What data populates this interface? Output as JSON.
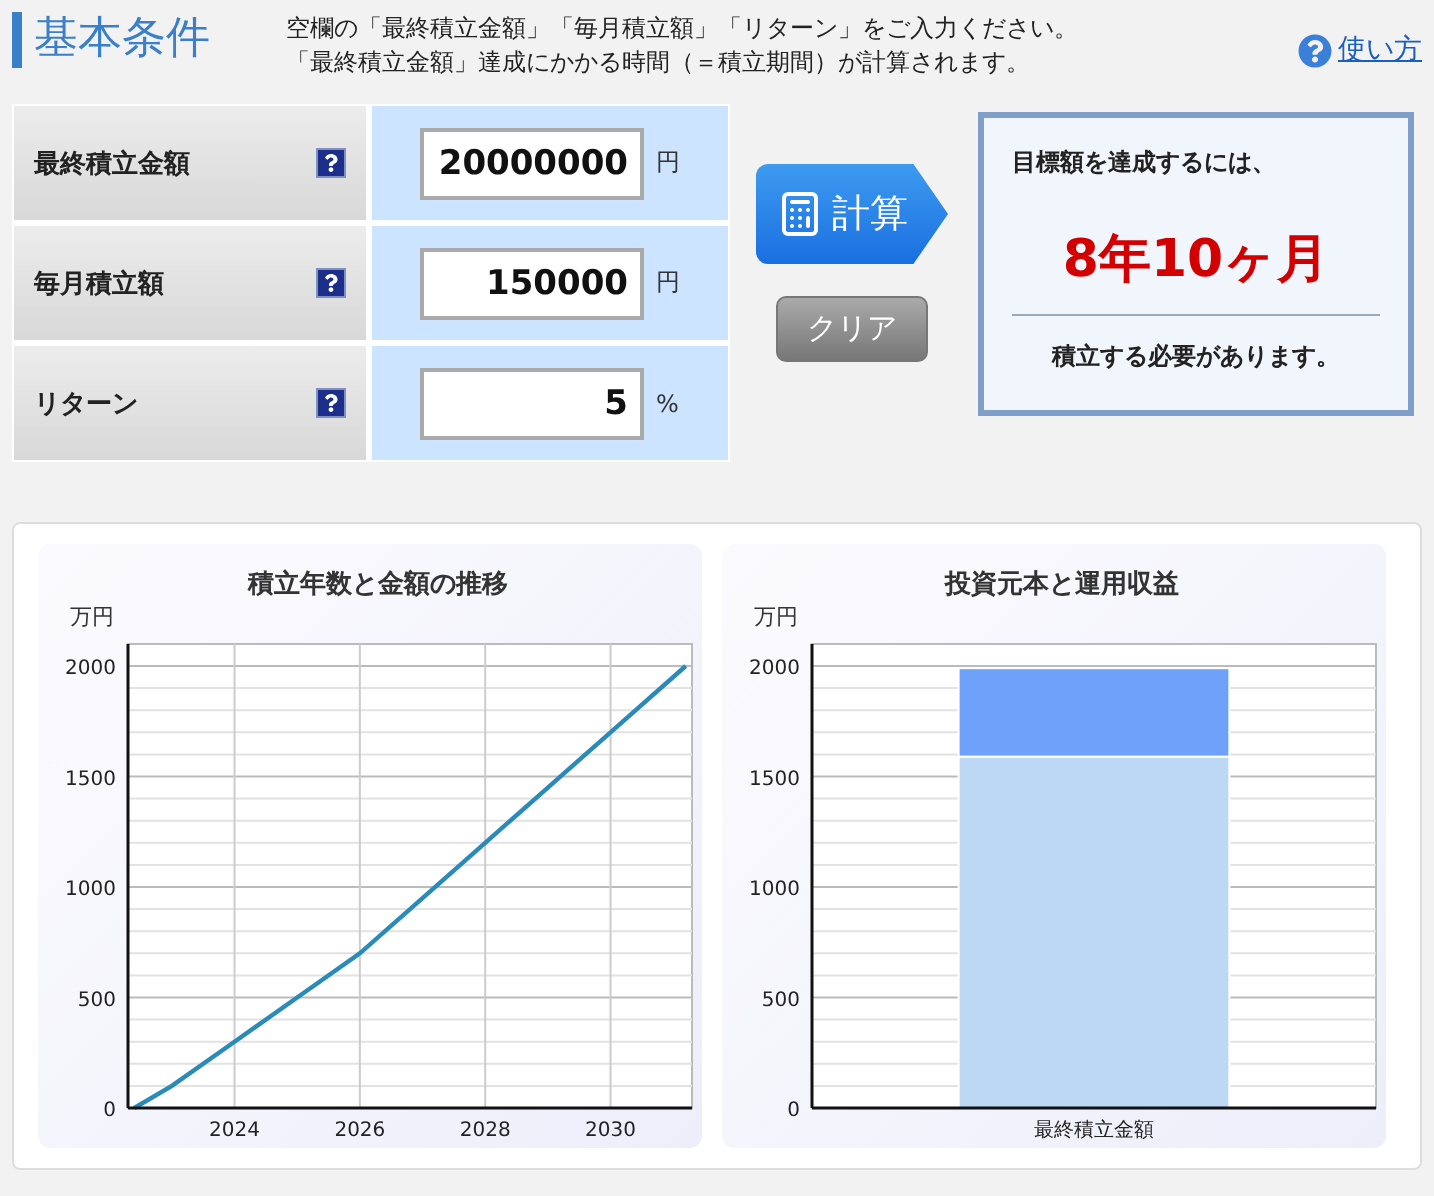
{
  "header": {
    "title": "基本条件",
    "instructions": [
      "空欄の「最終積立金額」「毎月積立額」「リターン」をご入力ください。",
      "「最終積立金額」達成にかかる時間（＝積立期間）が計算されます。"
    ],
    "help_link": "使い方"
  },
  "form": {
    "rows": [
      {
        "label": "最終積立金額",
        "value": "20000000",
        "unit": "円"
      },
      {
        "label": "毎月積立額",
        "value": "150000",
        "unit": "円"
      },
      {
        "label": "リターン",
        "value": "5",
        "unit": "%"
      }
    ]
  },
  "actions": {
    "calculate": "計算",
    "clear": "クリア"
  },
  "result": {
    "intro": "目標額を達成するには、",
    "duration": "8年10ヶ月",
    "outro": "積立する必要があります。"
  },
  "charts": [
    {
      "unit": "万円",
      "chart_data": {
        "type": "line",
        "title": "積立年数と金額の推移",
        "x": [
          2022.4,
          2023,
          2024,
          2025,
          2026,
          2027,
          2028,
          2029,
          2030,
          2031.2
        ],
        "series": [
          {
            "color": "#2a8ab8",
            "values": [
              0,
              100,
              300,
              500,
              700,
              950,
              1200,
              1450,
              1700,
              2000
            ]
          }
        ],
        "xlim": [
          2022.3,
          2031.3
        ],
        "ylim": [
          0,
          2000
        ],
        "grid": true,
        "xticks": [
          2024,
          2026,
          2028,
          2030
        ],
        "yticks": [
          0,
          500,
          1000,
          1500,
          2000
        ]
      }
    },
    {
      "unit": "万円",
      "chart_data": {
        "type": "bar",
        "title": "投資元本と運用収益",
        "categories": [
          "最終積立金額"
        ],
        "series": [
          {
            "color": "#bcd8f5",
            "values": [
              1590
            ]
          },
          {
            "color": "#6ea2fa",
            "values": [
              400
            ]
          }
        ],
        "stacked": true,
        "grid": true,
        "ylim": [
          0,
          2000
        ],
        "yticks": [
          0,
          500,
          1000,
          1500,
          2000
        ]
      }
    }
  ]
}
